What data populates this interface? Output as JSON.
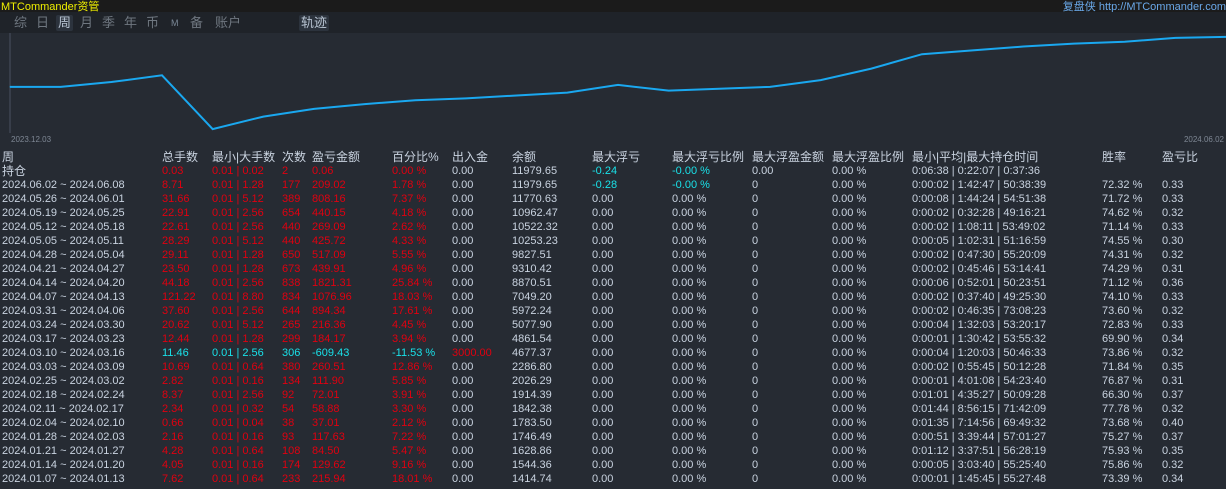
{
  "app": {
    "title": "MTCommander资管",
    "right_label": "复盘侠",
    "right_url": "http://MTCommander.com"
  },
  "tabs": [
    {
      "label": "综"
    },
    {
      "label": "日"
    },
    {
      "label": "周"
    },
    {
      "label": "月"
    },
    {
      "label": "季"
    },
    {
      "label": "年"
    },
    {
      "label": "币"
    },
    {
      "label": "M"
    },
    {
      "label": "备"
    },
    {
      "label": "账户"
    },
    {
      "label": "轨迹"
    }
  ],
  "active_tab": "周",
  "chart_data": {
    "type": "line",
    "title": "",
    "x_start_label": "2023.12.03",
    "x_end_label": "2024.06.02",
    "series": [
      {
        "name": "trajectory",
        "values": [
          46,
          46,
          51,
          58,
          2,
          15,
          23,
          28,
          32,
          34,
          37,
          40,
          48,
          42,
          44,
          46,
          53,
          65,
          80,
          84,
          88,
          91,
          93,
          97,
          98
        ]
      }
    ],
    "ylim": [
      0,
      100
    ],
    "color": "#1aa8f0"
  },
  "table": {
    "headers": [
      "周",
      "总手数",
      "最小|大手数",
      "次数",
      "盈亏金额",
      "百分比%",
      "出入金",
      "余额",
      "最大浮亏",
      "最大浮亏比例",
      "最大浮盈金额",
      "最大浮盈比例",
      "最小|平均|最大持仓时间",
      "胜率",
      "盈亏比"
    ],
    "rows": [
      [
        "持仓",
        "0.03",
        "0.01 | 0.02",
        "2",
        "0.06",
        "0.00 %",
        "0.00",
        "11979.65",
        "-0.24",
        "-0.00 %",
        "0.00",
        "0.00 %",
        "0:06:38 | 0:22:07 | 0:37:36",
        "",
        ""
      ],
      [
        "2024.06.02 ~ 2024.06.08",
        "8.71",
        "0.01 | 1.28",
        "177",
        "209.02",
        "1.78 %",
        "0.00",
        "11979.65",
        "-0.28",
        "-0.00 %",
        "0",
        "0.00 %",
        "0:00:02 | 1:42:47 | 50:38:39",
        "72.32 %",
        "0.33"
      ],
      [
        "2024.05.26 ~ 2024.06.01",
        "31.66",
        "0.01 | 5.12",
        "389",
        "808.16",
        "7.37 %",
        "0.00",
        "11770.63",
        "0.00",
        "0.00 %",
        "0",
        "0.00 %",
        "0:00:08 | 1:44:24 | 54:51:38",
        "71.72 %",
        "0.33"
      ],
      [
        "2024.05.19 ~ 2024.05.25",
        "22.91",
        "0.01 | 2.56",
        "654",
        "440.15",
        "4.18 %",
        "0.00",
        "10962.47",
        "0.00",
        "0.00 %",
        "0",
        "0.00 %",
        "0:00:02 | 0:32:28 | 49:16:21",
        "74.62 %",
        "0.32"
      ],
      [
        "2024.05.12 ~ 2024.05.18",
        "22.61",
        "0.01 | 2.56",
        "440",
        "269.09",
        "2.62 %",
        "0.00",
        "10522.32",
        "0.00",
        "0.00 %",
        "0",
        "0.00 %",
        "0:00:02 | 1:08:11 | 53:49:02",
        "71.14 %",
        "0.33"
      ],
      [
        "2024.05.05 ~ 2024.05.11",
        "28.29",
        "0.01 | 5.12",
        "440",
        "425.72",
        "4.33 %",
        "0.00",
        "10253.23",
        "0.00",
        "0.00 %",
        "0",
        "0.00 %",
        "0:00:05 | 1:02:31 | 51:16:59",
        "74.55 %",
        "0.30"
      ],
      [
        "2024.04.28 ~ 2024.05.04",
        "29.11",
        "0.01 | 1.28",
        "650",
        "517.09",
        "5.55 %",
        "0.00",
        "9827.51",
        "0.00",
        "0.00 %",
        "0",
        "0.00 %",
        "0:00:02 | 0:47:30 | 55:20:09",
        "74.31 %",
        "0.32"
      ],
      [
        "2024.04.21 ~ 2024.04.27",
        "23.50",
        "0.01 | 1.28",
        "673",
        "439.91",
        "4.96 %",
        "0.00",
        "9310.42",
        "0.00",
        "0.00 %",
        "0",
        "0.00 %",
        "0:00:02 | 0:45:46 | 53:14:41",
        "74.29 %",
        "0.31"
      ],
      [
        "2024.04.14 ~ 2024.04.20",
        "44.18",
        "0.01 | 2.56",
        "838",
        "1821.31",
        "25.84 %",
        "0.00",
        "8870.51",
        "0.00",
        "0.00 %",
        "0",
        "0.00 %",
        "0:00:06 | 0:52:01 | 50:23:51",
        "71.12 %",
        "0.36"
      ],
      [
        "2024.04.07 ~ 2024.04.13",
        "121.22",
        "0.01 | 8.80",
        "834",
        "1076.96",
        "18.03 %",
        "0.00",
        "7049.20",
        "0.00",
        "0.00 %",
        "0",
        "0.00 %",
        "0:00:02 | 0:37:40 | 49:25:30",
        "74.10 %",
        "0.33"
      ],
      [
        "2024.03.31 ~ 2024.04.06",
        "37.60",
        "0.01 | 2.56",
        "644",
        "894.34",
        "17.61 %",
        "0.00",
        "5972.24",
        "0.00",
        "0.00 %",
        "0",
        "0.00 %",
        "0:00:02 | 0:46:35 | 73:08:23",
        "73.60 %",
        "0.32"
      ],
      [
        "2024.03.24 ~ 2024.03.30",
        "20.62",
        "0.01 | 5.12",
        "265",
        "216.36",
        "4.45 %",
        "0.00",
        "5077.90",
        "0.00",
        "0.00 %",
        "0",
        "0.00 %",
        "0:00:04 | 1:32:03 | 53:20:17",
        "72.83 %",
        "0.33"
      ],
      [
        "2024.03.17 ~ 2024.03.23",
        "12.44",
        "0.01 | 1.28",
        "299",
        "184.17",
        "3.94 %",
        "0.00",
        "4861.54",
        "0.00",
        "0.00 %",
        "0",
        "0.00 %",
        "0:00:01 | 1:30:42 | 53:55:32",
        "69.90 %",
        "0.34"
      ],
      [
        "2024.03.10 ~ 2024.03.16",
        "11.46",
        "0.01 | 2.56",
        "306",
        "-609.43",
        "-11.53 %",
        "3000.00",
        "4677.37",
        "0.00",
        "0.00 %",
        "0",
        "0.00 %",
        "0:00:04 | 1:20:03 | 50:46:33",
        "73.86 %",
        "0.32"
      ],
      [
        "2024.03.03 ~ 2024.03.09",
        "10.69",
        "0.01 | 0.64",
        "380",
        "260.51",
        "12.86 %",
        "0.00",
        "2286.80",
        "0.00",
        "0.00 %",
        "0",
        "0.00 %",
        "0:00:02 | 0:55:45 | 50:12:28",
        "71.84 %",
        "0.35"
      ],
      [
        "2024.02.25 ~ 2024.03.02",
        "2.82",
        "0.01 | 0.16",
        "134",
        "111.90",
        "5.85 %",
        "0.00",
        "2026.29",
        "0.00",
        "0.00 %",
        "0",
        "0.00 %",
        "0:00:01 | 4:01:08 | 54:23:40",
        "76.87 %",
        "0.31"
      ],
      [
        "2024.02.18 ~ 2024.02.24",
        "8.37",
        "0.01 | 2.56",
        "92",
        "72.01",
        "3.91 %",
        "0.00",
        "1914.39",
        "0.00",
        "0.00 %",
        "0",
        "0.00 %",
        "0:01:01 | 4:35:27 | 50:09:28",
        "66.30 %",
        "0.37"
      ],
      [
        "2024.02.11 ~ 2024.02.17",
        "2.34",
        "0.01 | 0.32",
        "54",
        "58.88",
        "3.30 %",
        "0.00",
        "1842.38",
        "0.00",
        "0.00 %",
        "0",
        "0.00 %",
        "0:01:44 | 8:56:15 | 71:42:09",
        "77.78 %",
        "0.32"
      ],
      [
        "2024.02.04 ~ 2024.02.10",
        "0.66",
        "0.01 | 0.04",
        "38",
        "37.01",
        "2.12 %",
        "0.00",
        "1783.50",
        "0.00",
        "0.00 %",
        "0",
        "0.00 %",
        "0:01:35 | 7:14:56 | 69:49:32",
        "73.68 %",
        "0.40"
      ],
      [
        "2024.01.28 ~ 2024.02.03",
        "2.16",
        "0.01 | 0.16",
        "93",
        "117.63",
        "7.22 %",
        "0.00",
        "1746.49",
        "0.00",
        "0.00 %",
        "0",
        "0.00 %",
        "0:00:51 | 3:39:44 | 57:01:27",
        "75.27 %",
        "0.37"
      ],
      [
        "2024.01.21 ~ 2024.01.27",
        "4.28",
        "0.01 | 0.64",
        "108",
        "84.50",
        "5.47 %",
        "0.00",
        "1628.86",
        "0.00",
        "0.00 %",
        "0",
        "0.00 %",
        "0:01:12 | 3:37:51 | 56:28:19",
        "75.93 %",
        "0.35"
      ],
      [
        "2024.01.14 ~ 2024.01.20",
        "4.05",
        "0.01 | 0.16",
        "174",
        "129.62",
        "9.16 %",
        "0.00",
        "1544.36",
        "0.00",
        "0.00 %",
        "0",
        "0.00 %",
        "0:00:05 | 3:03:40 | 55:25:40",
        "75.86 %",
        "0.32"
      ],
      [
        "2024.01.07 ~ 2024.01.13",
        "7.62",
        "0.01 | 0.64",
        "233",
        "215.94",
        "18.01 %",
        "0.00",
        "1414.74",
        "0.00",
        "0.00 %",
        "0",
        "0.00 %",
        "0:00:01 | 1:45:45 | 55:27:48",
        "73.39 %",
        "0.34"
      ]
    ]
  },
  "colors": {
    "profit": "#e00010",
    "loss": "#19e0e8",
    "text": "#c9d3e0",
    "title": "#f0f000",
    "link": "#6aa8e8"
  }
}
